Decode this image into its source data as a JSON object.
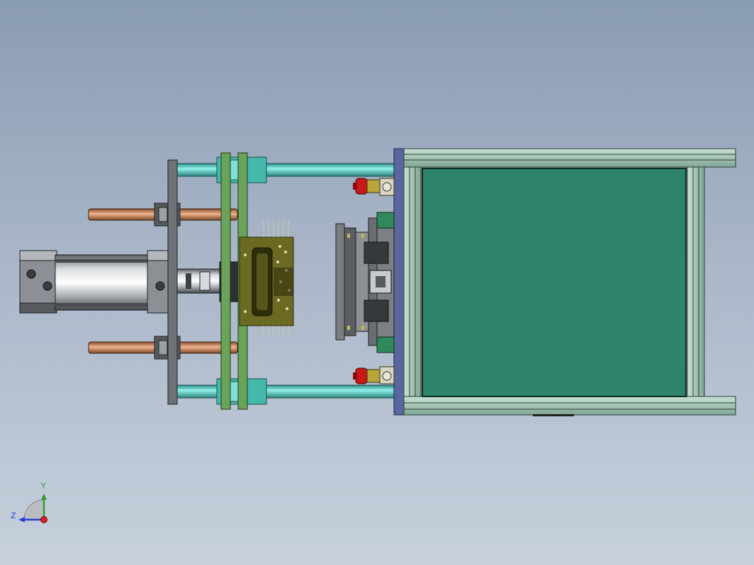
{
  "viewport": {
    "background_top": "#8a9bb4",
    "background_bottom": "#c7d0dc"
  },
  "triad": {
    "y_label": "Y",
    "z_label": "Z",
    "y_color": "#2ea02e",
    "z_color": "#2b3fd6",
    "x_color": "#d81e1e"
  },
  "colors": {
    "green_plate": "#6aa35a",
    "gray_plate": "#6e7277",
    "teal_rod": "#5fd6cc",
    "copper_rod": "#c9875e",
    "frame_rail": "#9fc4b2",
    "frame_panel": "#2e846a",
    "frame_end_plate": "#5a66a0",
    "pcb": "#6a6a22",
    "stop_button": "#c81818",
    "block_yellow": "#b9a63a"
  }
}
